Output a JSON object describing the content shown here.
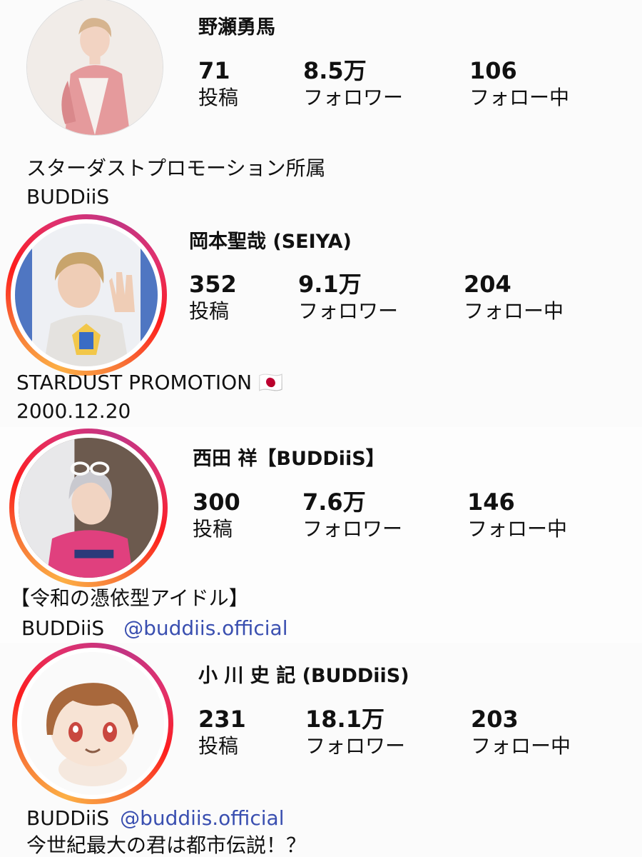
{
  "profiles": [
    {
      "name": "野瀬勇馬",
      "stats": [
        {
          "value": "71",
          "label": "投稿"
        },
        {
          "value": "8.5万",
          "label": "フォロワー"
        },
        {
          "value": "106",
          "label": "フォロー中"
        }
      ],
      "bio_line1": "スターダストプロモーション所属",
      "bio_line2": "BUDDiiS"
    },
    {
      "name": "岡本聖哉 (SEIYA)",
      "stats": [
        {
          "value": "352",
          "label": "投稿"
        },
        {
          "value": "9.1万",
          "label": "フォロワー"
        },
        {
          "value": "204",
          "label": "フォロー中"
        }
      ],
      "bio_line1": "STARDUST PROMOTION 🇯🇵",
      "bio_line2": "2000.12.20"
    },
    {
      "name": "西田 祥【BUDDiiS】",
      "stats": [
        {
          "value": "300",
          "label": "投稿"
        },
        {
          "value": "7.6万",
          "label": "フォロワー"
        },
        {
          "value": "146",
          "label": "フォロー中"
        }
      ],
      "bio_line1": "【令和の憑依型アイドル】",
      "bio_line2_text": "BUDDiiS",
      "bio_line2_link": "@buddiis.official"
    },
    {
      "name": "小 川 史 記 (BUDDiiS)",
      "stats": [
        {
          "value": "231",
          "label": "投稿"
        },
        {
          "value": "18.1万",
          "label": "フォロワー"
        },
        {
          "value": "203",
          "label": "フォロー中"
        }
      ],
      "bio_line1_text": "BUDDiiS",
      "bio_line1_link": "@buddiis.official",
      "bio_line2": "今世紀最大の君は都市伝説！？"
    }
  ],
  "colors": {
    "link": "#3a4fb0",
    "story_ring": [
      "#fcaf45",
      "#f77737",
      "#fd1d1d",
      "#e1306c",
      "#c13584"
    ]
  }
}
